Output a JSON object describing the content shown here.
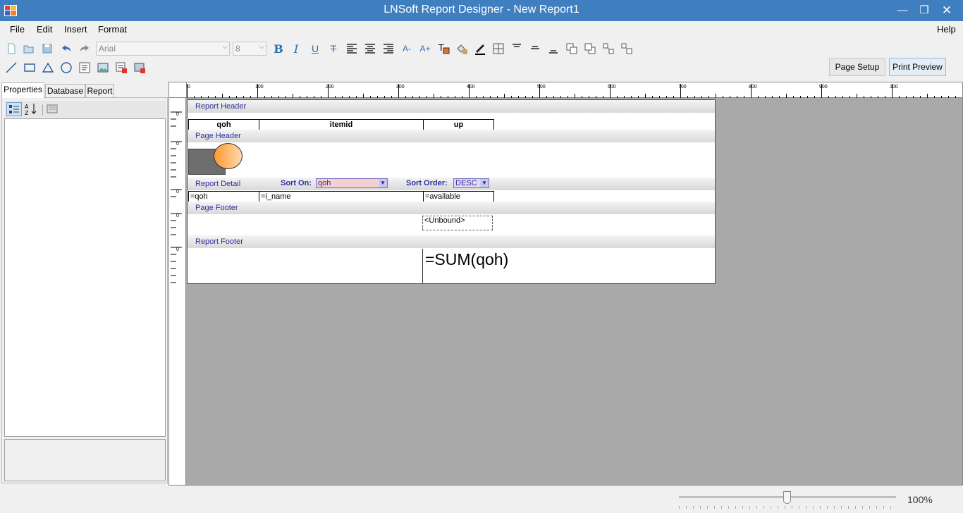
{
  "window": {
    "title": "LNSoft Report Designer -  New Report1",
    "minimize_glyph": "—",
    "maximize_glyph": "❐",
    "close_glyph": "✕"
  },
  "menu": {
    "file": "File",
    "edit": "Edit",
    "insert": "Insert",
    "format": "Format",
    "help": "Help"
  },
  "toolbar": {
    "font_name": "Arial",
    "font_size": "8",
    "bold": "B",
    "italic": "I",
    "underline": "U",
    "strike": "T",
    "page_setup": "Page Setup",
    "print_preview": "Print Preview"
  },
  "panel": {
    "tabs": [
      "Properties",
      "Database",
      "Report"
    ]
  },
  "ruler": {
    "h_labels": [
      "0",
      "100",
      "200",
      "300",
      "400",
      "500",
      "600",
      "700",
      "800",
      "900",
      "100"
    ],
    "v_label": "0"
  },
  "report": {
    "report_header": {
      "label": "Report Header",
      "columns": [
        "qoh",
        "itemid",
        "up"
      ]
    },
    "page_header": {
      "label": "Page Header"
    },
    "report_detail": {
      "label": "Report Detail",
      "sort_on_label": "Sort On:",
      "sort_on_value": "qoh",
      "sort_order_label": "Sort Order:",
      "sort_order_value": "DESC",
      "fields": [
        "=qoh",
        "=i_name",
        "=available"
      ]
    },
    "page_footer": {
      "label": "Page Footer",
      "unbound": "<Unbound>"
    },
    "report_footer": {
      "label": "Report Footer",
      "formula": "=SUM(qoh)"
    }
  },
  "status": {
    "zoom": "100%",
    "zoom_value": 0.5
  },
  "colors": {
    "titlebar": "#3f7fbf",
    "canvas": "#a9a9a9",
    "band_text": "#3030a0",
    "sort_on_bg": "#f4d0d0",
    "sort_order_bg": "#e0d8f4"
  }
}
